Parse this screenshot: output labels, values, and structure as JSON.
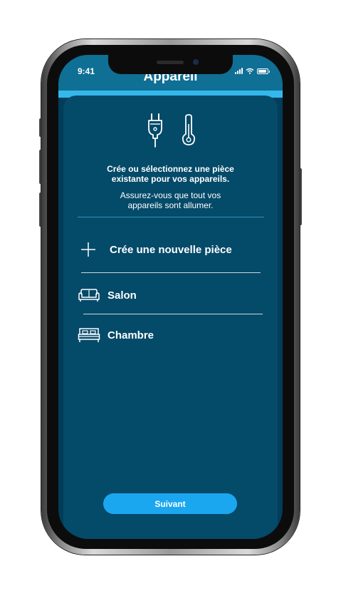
{
  "status": {
    "time": "9:41"
  },
  "header": {
    "title": "Appareil"
  },
  "intro": {
    "line1": "Crée ou sélectionnez une pièce",
    "line2": "existante pour vos appareils.",
    "sub1": "Assurez-vous que tout vos",
    "sub2": "appareils sont allumer."
  },
  "rooms": {
    "create_label": "Crée une nouvelle pièce",
    "items": [
      {
        "label": "Salon",
        "icon": "sofa-icon"
      },
      {
        "label": "Chambre",
        "icon": "bed-icon"
      }
    ]
  },
  "actions": {
    "next_label": "Suivant"
  },
  "colors": {
    "screen_bg": "#003d59",
    "card_bg": "#044a69",
    "header_bg": "#0f6f95",
    "accent": "#34b8ec",
    "button_bg": "#1ba7f0",
    "text": "#ffffff"
  }
}
